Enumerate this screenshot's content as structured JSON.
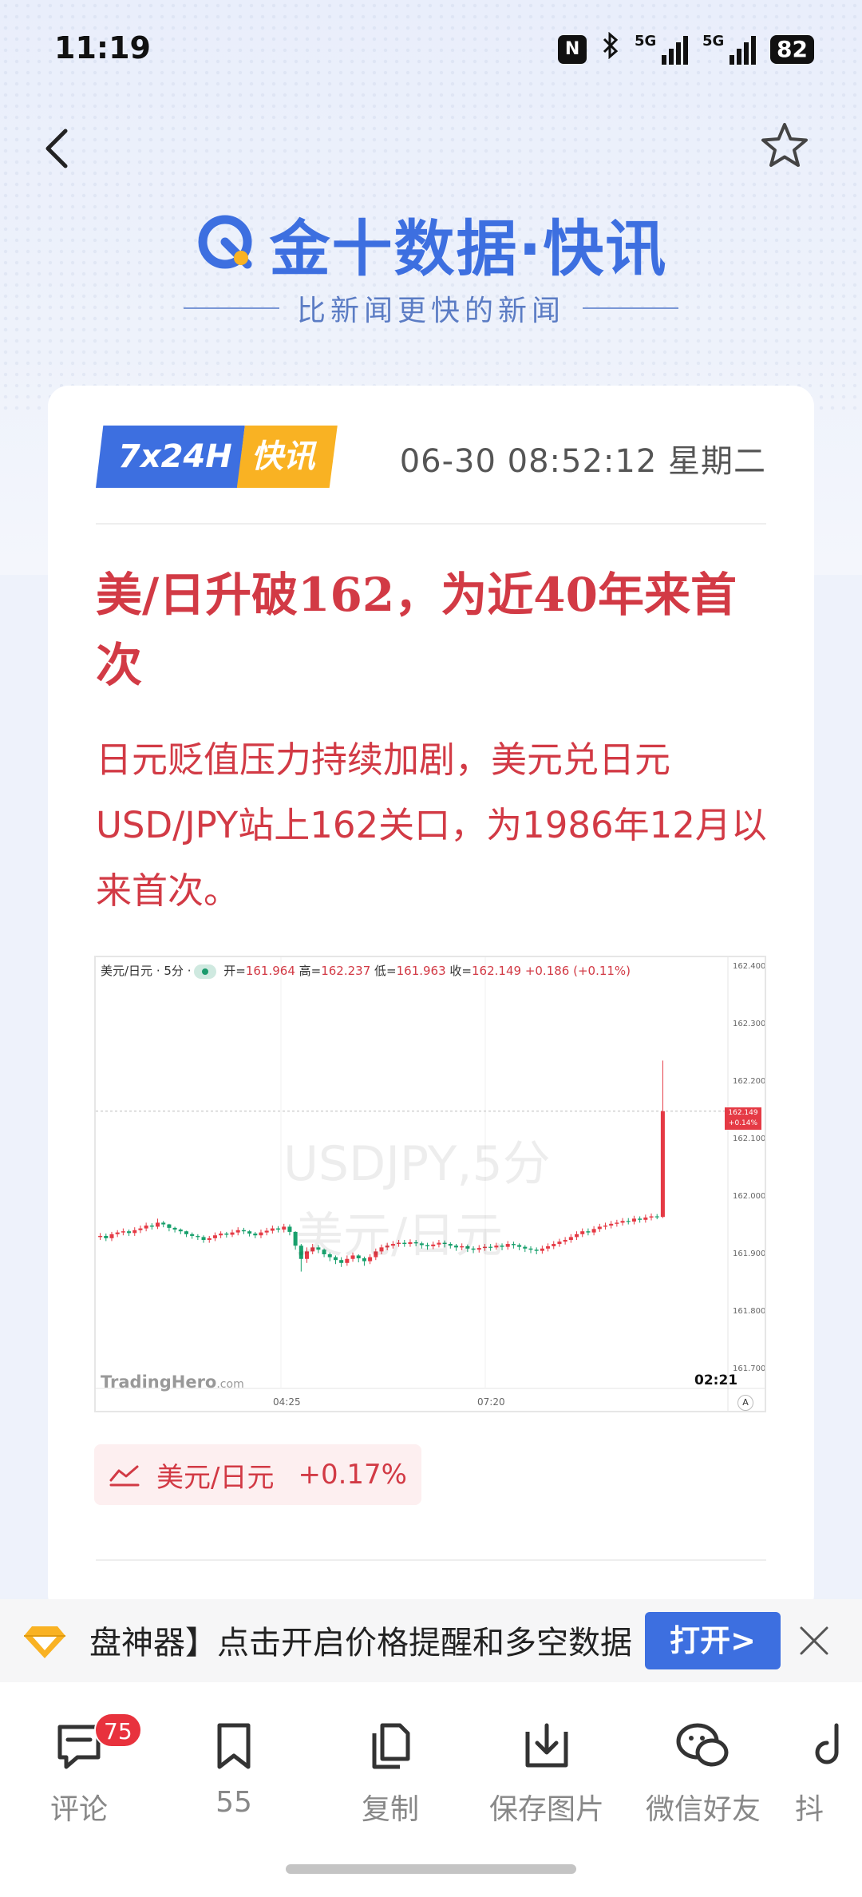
{
  "status_bar": {
    "time": "11:19",
    "battery": "82",
    "net1": "5G",
    "net2": "5G",
    "nfc": "N"
  },
  "header": {
    "brand": "金十数据·快讯",
    "slogan": "比新闻更快的新闻",
    "back_icon": "chevron-left-icon",
    "star_icon": "star-outline-icon"
  },
  "article": {
    "badge_left": "7x24H",
    "badge_right": "快讯",
    "datetime": "06-30 08:52:12 星期二",
    "headline": "美/日升破162，为近40年来首次",
    "summary": "日元贬值压力持续加剧，美元兑日元USD/JPY站上162关口，为1986年12月以来首次。"
  },
  "chart_header": {
    "symbol": "美元/日元",
    "interval": "5分",
    "open_label": "开=",
    "open": "161.964",
    "high_label": "高=",
    "high": "162.237",
    "low_label": "低=",
    "low": "161.963",
    "close_label": "收=",
    "close": "162.149",
    "change": "+0.186",
    "change_pct": "(+0.11%)"
  },
  "chart_data": {
    "type": "candlestick",
    "title": "",
    "watermark": [
      "USDJPY,5分",
      "美元/日元"
    ],
    "brand": "TradingHero",
    "brand_suffix": ".com",
    "time_label": "02:21",
    "x_ticks": [
      "04:25",
      "07:20"
    ],
    "y_ticks": [
      "162.400",
      "162.300",
      "162.200",
      "162.100",
      "162.000",
      "161.900",
      "161.800",
      "161.700"
    ],
    "ylim": [
      161.7,
      162.4
    ],
    "last_price": "162.149",
    "last_change": "+0.14%",
    "axis_button": "A",
    "x": [
      1,
      2,
      3,
      4,
      5,
      6,
      7,
      8,
      9,
      10,
      11,
      12,
      13,
      14,
      15,
      16,
      17,
      18,
      19,
      20,
      21,
      22,
      23,
      24,
      25,
      26,
      27,
      28,
      29,
      30,
      31,
      32,
      33,
      34,
      35,
      36,
      37,
      38,
      39,
      40,
      41,
      42,
      43,
      44,
      45,
      46,
      47,
      48,
      49,
      50,
      51,
      52,
      53,
      54,
      55,
      56,
      57,
      58,
      59,
      60,
      61,
      62,
      63,
      64,
      65,
      66,
      67,
      68,
      69,
      70,
      71,
      72,
      73,
      74,
      75,
      76,
      77,
      78,
      79,
      80,
      81,
      82,
      83,
      84,
      85,
      86,
      87,
      88,
      89,
      90,
      91,
      92,
      93,
      94,
      95,
      96,
      97,
      98,
      99
    ],
    "open": [
      161.93,
      161.932,
      161.928,
      161.935,
      161.938,
      161.94,
      161.937,
      161.942,
      161.945,
      161.95,
      161.948,
      161.955,
      161.952,
      161.946,
      161.943,
      161.94,
      161.935,
      161.932,
      161.93,
      161.925,
      161.928,
      161.933,
      161.936,
      161.934,
      161.938,
      161.942,
      161.94,
      161.936,
      161.933,
      161.938,
      161.941,
      161.945,
      161.943,
      161.948,
      161.939,
      161.915,
      161.892,
      161.905,
      161.912,
      161.908,
      161.9,
      161.895,
      161.89,
      161.885,
      161.892,
      161.898,
      161.893,
      161.888,
      161.895,
      161.905,
      161.912,
      161.915,
      161.918,
      161.92,
      161.918,
      161.921,
      161.919,
      161.916,
      161.914,
      161.917,
      161.92,
      161.918,
      161.915,
      161.912,
      161.914,
      161.91,
      161.908,
      161.911,
      161.913,
      161.912,
      161.915,
      161.913,
      161.918,
      161.916,
      161.913,
      161.91,
      161.908,
      161.906,
      161.91,
      161.914,
      161.918,
      161.922,
      161.925,
      161.93,
      161.935,
      161.94,
      161.938,
      161.944,
      161.948,
      161.95,
      161.953,
      161.955,
      161.958,
      161.957,
      161.962,
      161.96,
      161.964,
      161.966,
      161.965
    ],
    "close": [
      161.932,
      161.928,
      161.935,
      161.938,
      161.94,
      161.937,
      161.942,
      161.945,
      161.95,
      161.948,
      161.955,
      161.952,
      161.946,
      161.943,
      161.94,
      161.935,
      161.932,
      161.93,
      161.925,
      161.928,
      161.933,
      161.936,
      161.934,
      161.938,
      161.942,
      161.94,
      161.936,
      161.933,
      161.938,
      161.941,
      161.945,
      161.943,
      161.948,
      161.939,
      161.915,
      161.892,
      161.905,
      161.912,
      161.908,
      161.9,
      161.895,
      161.89,
      161.885,
      161.892,
      161.898,
      161.893,
      161.888,
      161.895,
      161.905,
      161.912,
      161.915,
      161.918,
      161.92,
      161.918,
      161.921,
      161.919,
      161.916,
      161.914,
      161.917,
      161.92,
      161.918,
      161.915,
      161.912,
      161.914,
      161.91,
      161.908,
      161.911,
      161.913,
      161.912,
      161.915,
      161.913,
      161.918,
      161.916,
      161.913,
      161.91,
      161.908,
      161.906,
      161.91,
      161.914,
      161.918,
      161.922,
      161.925,
      161.93,
      161.935,
      161.94,
      161.938,
      161.944,
      161.948,
      161.95,
      161.953,
      161.955,
      161.958,
      161.957,
      161.962,
      161.96,
      161.964,
      161.966,
      161.965,
      162.149
    ],
    "high": [
      161.937,
      161.936,
      161.939,
      161.942,
      161.945,
      161.943,
      161.947,
      161.95,
      161.955,
      161.954,
      161.962,
      161.958,
      161.953,
      161.948,
      161.945,
      161.941,
      161.938,
      161.935,
      161.933,
      161.932,
      161.938,
      161.94,
      161.939,
      161.943,
      161.947,
      161.946,
      161.942,
      161.939,
      161.943,
      161.946,
      161.95,
      161.949,
      161.953,
      161.952,
      161.94,
      161.918,
      161.912,
      161.918,
      161.916,
      161.91,
      161.903,
      161.898,
      161.895,
      161.898,
      161.903,
      161.9,
      161.896,
      161.9,
      161.91,
      161.917,
      161.92,
      161.923,
      161.925,
      161.925,
      161.926,
      161.925,
      161.922,
      161.92,
      161.922,
      161.925,
      161.924,
      161.921,
      161.918,
      161.919,
      161.917,
      161.914,
      161.916,
      161.918,
      161.918,
      161.92,
      161.919,
      161.923,
      161.922,
      161.919,
      161.916,
      161.914,
      161.912,
      161.915,
      161.919,
      161.923,
      161.927,
      161.93,
      161.935,
      161.94,
      161.945,
      161.945,
      161.949,
      161.953,
      161.955,
      161.958,
      161.96,
      161.963,
      161.963,
      161.967,
      161.966,
      161.969,
      161.971,
      161.97,
      162.237
    ],
    "low": [
      161.925,
      161.923,
      161.923,
      161.93,
      161.933,
      161.932,
      161.932,
      161.937,
      161.94,
      161.943,
      161.944,
      161.947,
      161.94,
      161.938,
      161.935,
      161.93,
      161.927,
      161.925,
      161.92,
      161.92,
      161.923,
      161.928,
      161.929,
      161.93,
      161.933,
      161.935,
      161.931,
      161.928,
      161.928,
      161.933,
      161.936,
      161.938,
      161.938,
      161.933,
      161.908,
      161.87,
      161.885,
      161.9,
      161.902,
      161.895,
      161.888,
      161.883,
      161.878,
      161.88,
      161.887,
      161.886,
      161.88,
      161.883,
      161.89,
      161.9,
      161.907,
      161.91,
      161.913,
      161.913,
      161.913,
      161.914,
      161.91,
      161.908,
      161.909,
      161.912,
      161.912,
      161.91,
      161.906,
      161.907,
      161.904,
      161.902,
      161.903,
      161.906,
      161.906,
      161.908,
      161.907,
      161.908,
      161.91,
      161.907,
      161.904,
      161.902,
      161.9,
      161.901,
      161.905,
      161.909,
      161.913,
      161.917,
      161.92,
      161.925,
      161.93,
      161.933,
      161.933,
      161.939,
      161.943,
      161.945,
      161.948,
      161.95,
      161.952,
      161.952,
      161.955,
      161.955,
      161.959,
      161.961,
      161.963
    ]
  },
  "quote": {
    "name": "美元/日元",
    "change": "+0.17%",
    "icon": "trend-line-icon"
  },
  "promo": {
    "text": "盘神器】点击开启价格提醒和多空数据",
    "button": "打开>",
    "icon": "diamond-icon",
    "close_icon": "close-icon"
  },
  "toolbar": {
    "comment_label": "评论",
    "comment_count": "75",
    "bookmark_label": "55",
    "copy_label": "复制",
    "save_label": "保存图片",
    "wechat_label": "微信好友",
    "douyin_label": "抖"
  }
}
